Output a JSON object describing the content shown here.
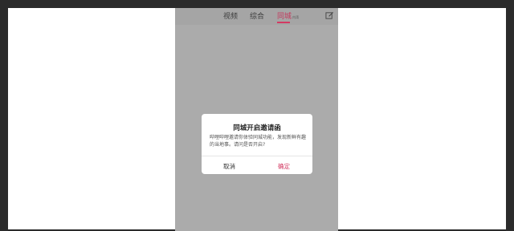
{
  "tabs": [
    {
      "label": "视频"
    },
    {
      "label": "综合"
    },
    {
      "label": "同城",
      "sub": "内湾"
    }
  ],
  "icons": {
    "edit": "edit-icon"
  },
  "colors": {
    "accent": "#d33a63",
    "overlay": "#ababab"
  },
  "dialog": {
    "title": "同城开启邀请函",
    "body": "哔哩哔哩邀请你体验同城功能，发现新鲜有趣的当地事。请问是否开启?",
    "cancel": "取消",
    "confirm": "确定"
  }
}
